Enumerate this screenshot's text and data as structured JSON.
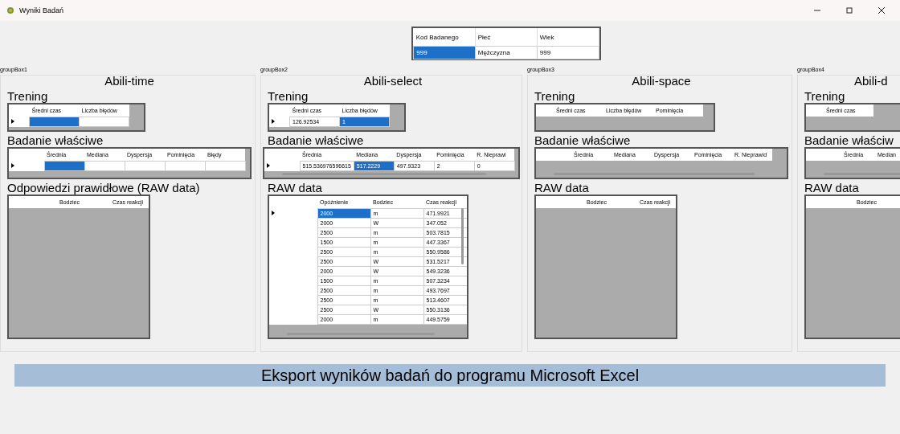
{
  "window": {
    "title": "Wyniki Badań"
  },
  "subject_table": {
    "columns": [
      "Kod Badanego",
      "Płeć",
      "Wiek"
    ],
    "rows": [
      {
        "cells": [
          {
            "text": "999",
            "selected": true
          },
          {
            "text": "Mężczyzna",
            "selected": false
          },
          {
            "text": "999",
            "selected": false
          }
        ]
      }
    ]
  },
  "panels": [
    {
      "group_label": "groupBox1",
      "title": "Abili-time",
      "sections": [
        {
          "kind": "small",
          "heading": "Trening",
          "columns": [
            "Średni czas",
            "Liczba błędów"
          ],
          "rows": [
            {
              "current": true,
              "cells": [
                {
                  "selected": true
                },
                {
                  "selected": false
                }
              ]
            }
          ]
        },
        {
          "kind": "wide",
          "heading": "Badanie właściwe",
          "columns": [
            "Średnia",
            "Mediana",
            "Dyspersja",
            "Pominięcia",
            "Błędy"
          ],
          "rows": [
            {
              "current": true,
              "cells": [
                {
                  "selected": true
                },
                {
                  "selected": false
                },
                {
                  "selected": false
                },
                {
                  "selected": false
                },
                {
                  "selected": false
                }
              ]
            }
          ]
        },
        {
          "kind": "raw",
          "heading": "Odpowiedzi prawidłowe (RAW data)",
          "columns": [
            "Bodziec",
            "Czas reakcji"
          ]
        }
      ]
    },
    {
      "group_label": "groupBox2",
      "title": "Abili-select",
      "sections": [
        {
          "kind": "small",
          "heading": "Trening",
          "columns": [
            "Średni czas",
            "Liczba błędów"
          ],
          "rows": [
            {
              "current": true,
              "cells": [
                {
                  "text": "126.92534",
                  "selected": false
                },
                {
                  "text": "1",
                  "selected": true
                }
              ]
            }
          ]
        },
        {
          "kind": "wide",
          "heading": "Badanie właściwe",
          "columns": [
            "Średnia",
            "Mediana",
            "Dyspersja",
            "Pominięcia",
            "R. Nieprawi"
          ],
          "rows": [
            {
              "current": true,
              "cells": [
                {
                  "text": "515.536976596615",
                  "selected": false
                },
                {
                  "text": "517.2229",
                  "selected": true
                },
                {
                  "text": "497.9323",
                  "selected": false
                },
                {
                  "text": "2",
                  "selected": false
                },
                {
                  "text": "0",
                  "selected": false
                }
              ]
            }
          ]
        },
        {
          "kind": "raw",
          "heading": "RAW data",
          "columns": [
            "Opóźnienie",
            "Bodziec",
            "Czas reakcji"
          ],
          "rows": [
            {
              "current": true,
              "cells": [
                {
                  "text": "2000",
                  "selected": true
                },
                {
                  "text": "m",
                  "selected": false
                },
                {
                  "text": "471.9921",
                  "selected": false
                }
              ]
            },
            {
              "current": false,
              "cells": [
                {
                  "text": "2000",
                  "selected": false
                },
                {
                  "text": "W",
                  "selected": false
                },
                {
                  "text": "347.052",
                  "selected": false
                }
              ]
            },
            {
              "current": false,
              "cells": [
                {
                  "text": "2500",
                  "selected": false
                },
                {
                  "text": "m",
                  "selected": false
                },
                {
                  "text": "503.7815",
                  "selected": false
                }
              ]
            },
            {
              "current": false,
              "cells": [
                {
                  "text": "1500",
                  "selected": false
                },
                {
                  "text": "m",
                  "selected": false
                },
                {
                  "text": "447.3367",
                  "selected": false
                }
              ]
            },
            {
              "current": false,
              "cells": [
                {
                  "text": "2500",
                  "selected": false
                },
                {
                  "text": "m",
                  "selected": false
                },
                {
                  "text": "550.9586",
                  "selected": false
                }
              ]
            },
            {
              "current": false,
              "cells": [
                {
                  "text": "2500",
                  "selected": false
                },
                {
                  "text": "W",
                  "selected": false
                },
                {
                  "text": "531.5217",
                  "selected": false
                }
              ]
            },
            {
              "current": false,
              "cells": [
                {
                  "text": "2000",
                  "selected": false
                },
                {
                  "text": "W",
                  "selected": false
                },
                {
                  "text": "549.3236",
                  "selected": false
                }
              ]
            },
            {
              "current": false,
              "cells": [
                {
                  "text": "1500",
                  "selected": false
                },
                {
                  "text": "m",
                  "selected": false
                },
                {
                  "text": "507.3234",
                  "selected": false
                }
              ]
            },
            {
              "current": false,
              "cells": [
                {
                  "text": "2500",
                  "selected": false
                },
                {
                  "text": "m",
                  "selected": false
                },
                {
                  "text": "493.7697",
                  "selected": false
                }
              ]
            },
            {
              "current": false,
              "cells": [
                {
                  "text": "2500",
                  "selected": false
                },
                {
                  "text": "m",
                  "selected": false
                },
                {
                  "text": "513.4607",
                  "selected": false
                }
              ]
            },
            {
              "current": false,
              "cells": [
                {
                  "text": "2500",
                  "selected": false
                },
                {
                  "text": "W",
                  "selected": false
                },
                {
                  "text": "550.3136",
                  "selected": false
                }
              ]
            },
            {
              "current": false,
              "cells": [
                {
                  "text": "2000",
                  "selected": false
                },
                {
                  "text": "m",
                  "selected": false
                },
                {
                  "text": "449.5759",
                  "selected": false
                }
              ]
            }
          ]
        }
      ]
    },
    {
      "group_label": "groupBox3",
      "title": "Abili-space",
      "sections": [
        {
          "kind": "small",
          "heading": "Trening",
          "columns": [
            "Średni czas",
            "Liczba błędów",
            "Pominięcia"
          ]
        },
        {
          "kind": "wide",
          "heading": "Badanie właściwe",
          "columns": [
            "Średnia",
            "Mediana",
            "Dyspersja",
            "Pominięcia",
            "R. Nieprawid"
          ]
        },
        {
          "kind": "raw",
          "heading": "RAW data",
          "columns": [
            "Bodziec",
            "Czas reakcji"
          ]
        }
      ]
    },
    {
      "group_label": "groupBox4",
      "title": "Abili-d",
      "sections": [
        {
          "kind": "small",
          "heading": "Trening",
          "columns": [
            "Średni czas"
          ]
        },
        {
          "kind": "wide",
          "heading": "Badanie właściw",
          "columns": [
            "Średnia",
            "Median"
          ]
        },
        {
          "kind": "raw",
          "heading": "RAW data",
          "columns": [
            "Bodziec"
          ]
        }
      ]
    }
  ],
  "export_button": {
    "label": "Eksport wyników badań do programu Microsoft Excel"
  }
}
